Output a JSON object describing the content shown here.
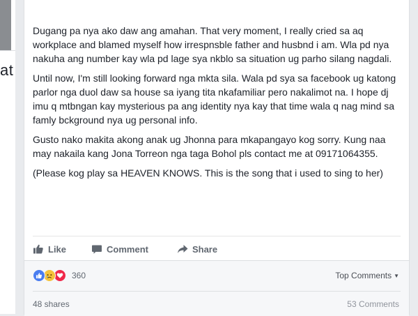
{
  "left_column": {
    "fragment_text": "at"
  },
  "post": {
    "paragraphs": [
      "Dugang pa nya ako daw ang amahan. That very moment, I really cried sa aq workplace and blamed myself how irrespnsble father and husbnd i am. Wla pd nya nakuha ang number kay wla pd lage sya nkblo sa situation ug parho silang nagdali.",
      "Until now, I'm still looking forward nga mkta sila. Wala pd sya sa facebook ug katong parlor nga duol daw sa house sa iyang tita nkafamiliar pero nakalimot na. I hope dj imu q mtbngan kay mysterious pa ang identity nya kay that time wala q nag mind sa famly bckground nya ug personal info.",
      "Gusto nako makita akong anak ug Jhonna para mkapangayo kog sorry. Kung naa may nakaila kang Jona Torreon nga taga Bohol pls contact me at 09171064355.",
      "(Please kog play sa HEAVEN KNOWS. This is the song that i used to sing to her)"
    ]
  },
  "actions": {
    "like_label": "Like",
    "comment_label": "Comment",
    "share_label": "Share"
  },
  "reactions": {
    "icons": [
      "like-reaction-icon",
      "sad-reaction-icon",
      "love-reaction-icon"
    ],
    "count": "360",
    "colors": {
      "like": "#4a7df0",
      "sad": "#f5c33b",
      "love": "#f0284a"
    }
  },
  "sort": {
    "label": "Top Comments"
  },
  "stats": {
    "shares": "48 shares",
    "comments": "53 Comments"
  }
}
